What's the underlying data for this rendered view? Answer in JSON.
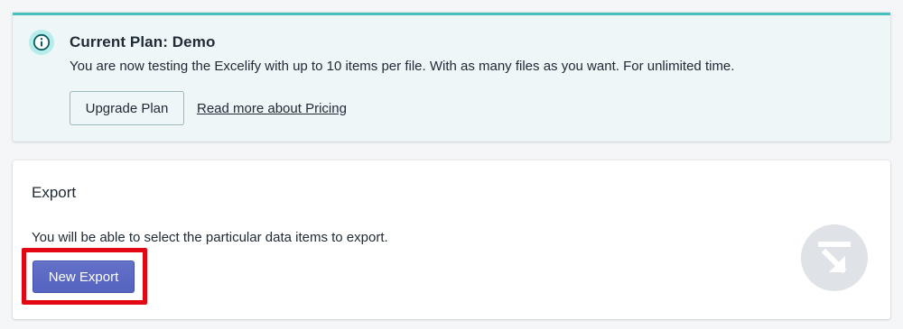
{
  "banner": {
    "icon": "info-icon",
    "title": "Current Plan: Demo",
    "text": "You are now testing the Excelify with up to 10 items per file. With as many files as you want. For unlimited time.",
    "upgrade_label": "Upgrade Plan",
    "pricing_link": "Read more about Pricing",
    "accent_color": "#47c1bf"
  },
  "export": {
    "title": "Export",
    "text": "You will be able to select the particular data items to export.",
    "new_export_label": "New Export",
    "icon": "export-arrow-icon",
    "button_color": "#5c6ac4",
    "highlight_color": "#e30613"
  }
}
